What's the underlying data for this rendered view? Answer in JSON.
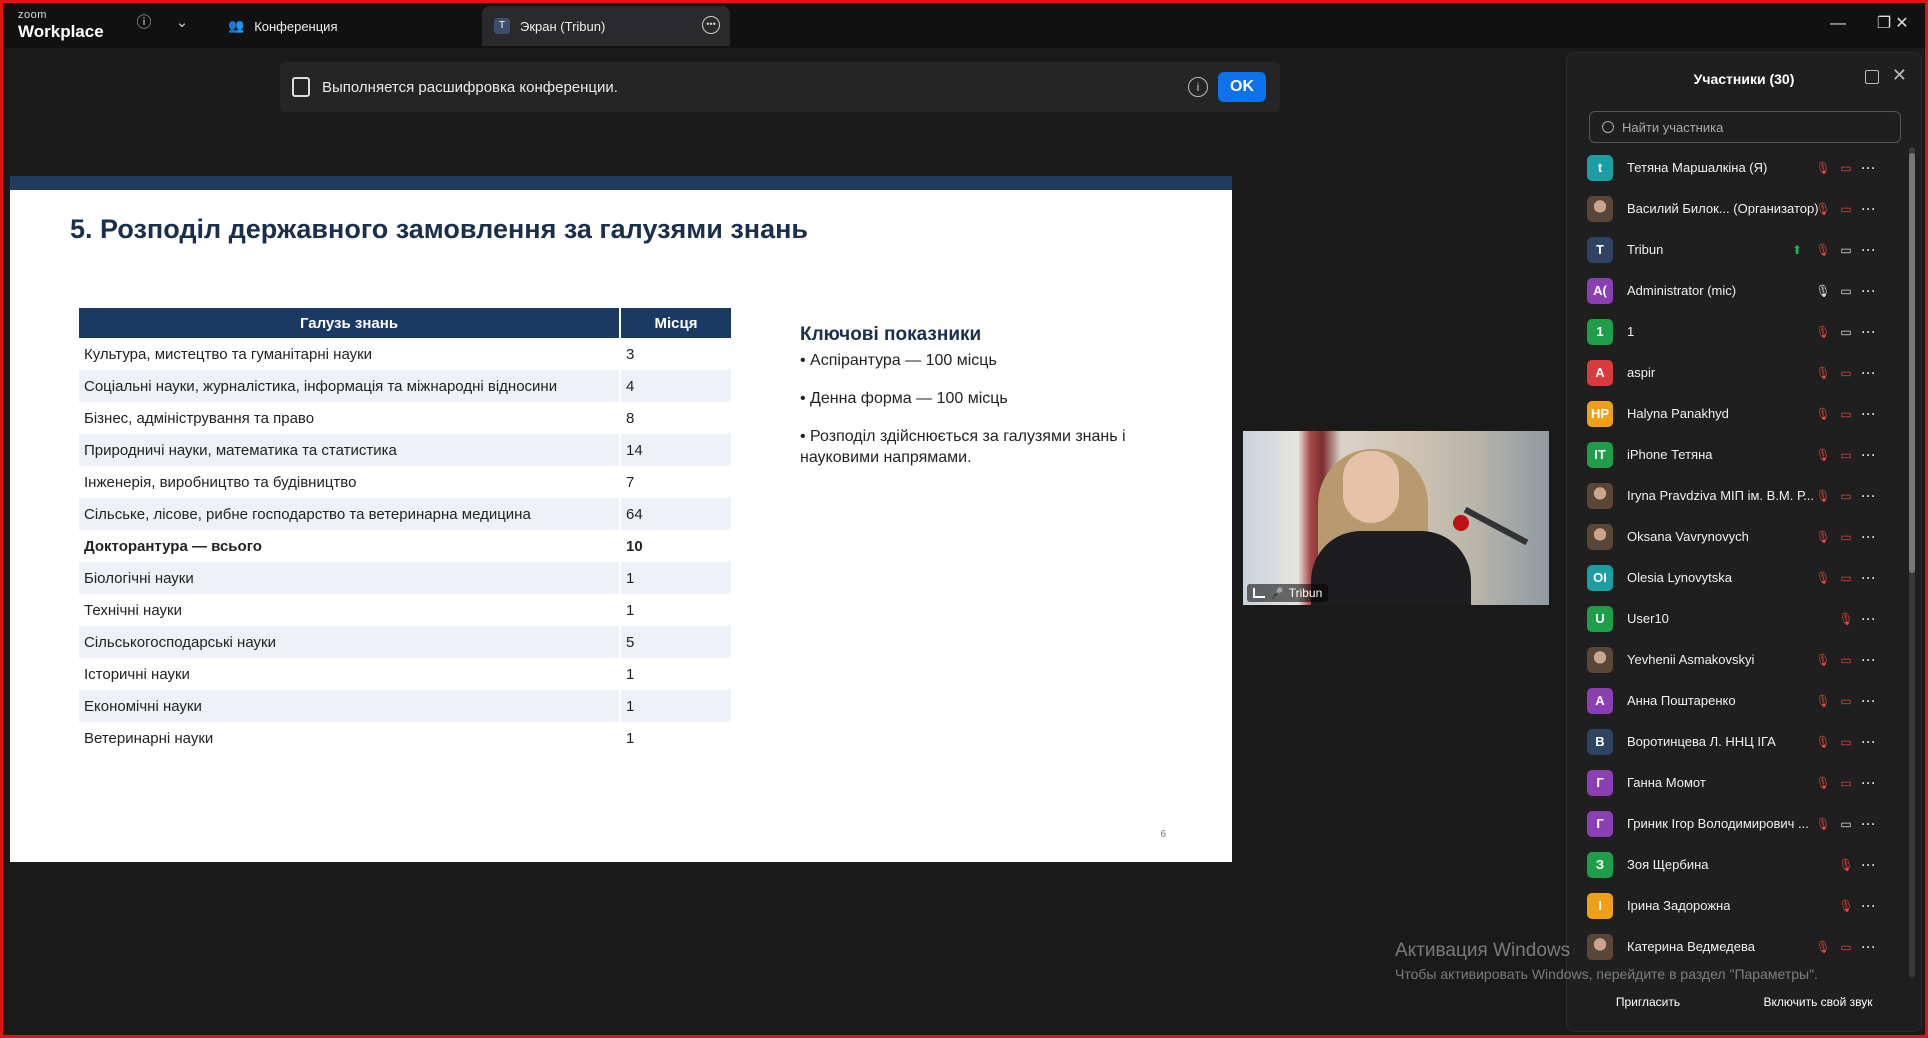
{
  "app": {
    "logo_small": "zoom",
    "logo_big": "Workplace"
  },
  "tabs": [
    {
      "label": "Конференция",
      "icon": "people-icon"
    },
    {
      "label": "Экран (Tribun)",
      "icon_letter": "T"
    }
  ],
  "banner": {
    "text": "Выполняется расшифровка конференции.",
    "ok": "OK"
  },
  "slide": {
    "title": "5. Розподіл державного замовлення за галузями знань",
    "table_headers": [
      "Галузь знань",
      "Місця"
    ],
    "rows": [
      {
        "field": "Культура, мистецтво та гуманітарні науки",
        "places": "3"
      },
      {
        "field": "Соціальні науки, журналістика, інформація та міжнародні відносини",
        "places": "4"
      },
      {
        "field": "Бізнес, адміністрування та право",
        "places": "8"
      },
      {
        "field": "Природничі науки, математика та статистика",
        "places": "14"
      },
      {
        "field": "Інженерія, виробництво та будівництво",
        "places": "7"
      },
      {
        "field": "Сільське, лісове, рибне господарство та ветеринарна медицина",
        "places": "64"
      },
      {
        "field": "Докторантура — всього",
        "places": "10"
      },
      {
        "field": "Біологічні науки",
        "places": "1"
      },
      {
        "field": "Технічні науки",
        "places": "1"
      },
      {
        "field": "Сільськогосподарські науки",
        "places": "5"
      },
      {
        "field": "Історичні науки",
        "places": "1"
      },
      {
        "field": "Економічні науки",
        "places": "1"
      },
      {
        "field": "Ветеринарні науки",
        "places": "1"
      }
    ],
    "key_title": "Ключові показники",
    "key_items": [
      "• Аспірантура — 100 місць",
      "• Денна форма — 100 місць",
      "• Розподіл здійснюється за галузями знань і науковими напрямами."
    ],
    "page_number": "6"
  },
  "video": {
    "name": "Tribun"
  },
  "participants": {
    "title": "Участники (30)",
    "search_placeholder": "Найти участника",
    "list": [
      {
        "name": "Тетяна Маршалкіна (Я)",
        "initials": "t",
        "color": "#1a9ea3",
        "audio": "muted",
        "video": "off"
      },
      {
        "name": "Василий Билок... (Организатор)",
        "initials": "",
        "photo": true,
        "audio": "muted",
        "video": "off"
      },
      {
        "name": "Tribun",
        "initials": "T",
        "color": "#2f4463",
        "audio": "muted",
        "video": "on",
        "sharing": true
      },
      {
        "name": "Administrator (mic)",
        "initials": "A(",
        "color": "#8a3fb3",
        "audio": "on",
        "video": "on"
      },
      {
        "name": "1",
        "initials": "1",
        "color": "#1f9e4a",
        "audio": "muted",
        "video": "on"
      },
      {
        "name": "aspir",
        "initials": "A",
        "color": "#d83b3b",
        "audio": "muted",
        "video": "off"
      },
      {
        "name": "Halyna Panakhyd",
        "initials": "HP",
        "color": "#f0a018",
        "audio": "muted",
        "video": "off"
      },
      {
        "name": "iPhone Тетяна",
        "initials": "IT",
        "color": "#1f9e4a",
        "audio": "muted",
        "video": "off"
      },
      {
        "name": "Iryna Pravdziva МІП ім. В.М. Р...",
        "initials": "",
        "photo": true,
        "audio": "muted",
        "video": "off"
      },
      {
        "name": "Oksana Vavrynovych",
        "initials": "",
        "photo": true,
        "audio": "muted",
        "video": "off"
      },
      {
        "name": "Olesia Lynovytska",
        "initials": "OI",
        "color": "#1a9ea3",
        "audio": "muted",
        "video": "off"
      },
      {
        "name": "User10",
        "initials": "U",
        "color": "#1f9e4a",
        "audio": "muted",
        "video": ""
      },
      {
        "name": "Yevhenii Asmakovskyi",
        "initials": "",
        "photo": true,
        "audio": "muted",
        "video": "off"
      },
      {
        "name": "Анна Поштаренко",
        "initials": "A",
        "color": "#8a3fb3",
        "audio": "muted",
        "video": "off"
      },
      {
        "name": "Воротинцева Л. ННЦ ІГА",
        "initials": "B",
        "color": "#2f4463",
        "audio": "muted",
        "video": "off"
      },
      {
        "name": "Ганна Момот",
        "initials": "Г",
        "color": "#8a3fb3",
        "audio": "muted",
        "video": "off"
      },
      {
        "name": "Гриник Ігор Володимирович ...",
        "initials": "Г",
        "color": "#8a3fb3",
        "audio": "muted",
        "video": "on"
      },
      {
        "name": "Зоя Щербина",
        "initials": "З",
        "color": "#1f9e4a",
        "audio": "muted",
        "video": ""
      },
      {
        "name": "Ірина Задорожна",
        "initials": "І",
        "color": "#f0a018",
        "audio": "muted",
        "video": ""
      },
      {
        "name": "Катерина Ведмедева",
        "initials": "",
        "photo": true,
        "audio": "muted",
        "video": "off"
      }
    ],
    "invite": "Пригласить",
    "unmute": "Включить свой звук"
  },
  "watermark": {
    "line1": "Активация Windows",
    "line2": "Чтобы активировать Windows, перейдите в раздел \"Параметры\"."
  },
  "colors": {
    "accent": "#0e72ed",
    "slide_header": "#1b3a63",
    "muted": "#e0453a"
  }
}
